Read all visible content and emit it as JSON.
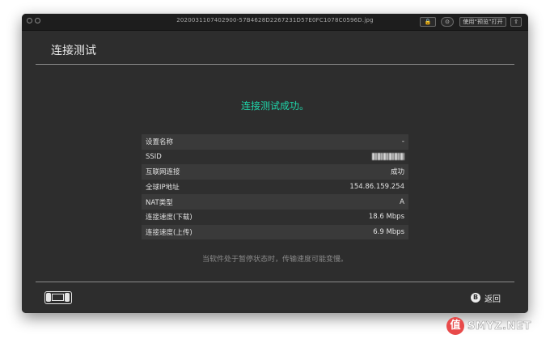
{
  "window": {
    "title": "2020031107402900-57B4628D2267231D57E0FC1078C0596D.jpg",
    "buttons": {
      "lock": "🔒",
      "markup": "⊙",
      "open_preview": "使用“预览”打开",
      "share": "⇧"
    }
  },
  "page": {
    "title": "连接测试",
    "result": "连接测试成功。",
    "rows": [
      {
        "label": "设置名称",
        "value": "-"
      },
      {
        "label": "SSID",
        "value": ""
      },
      {
        "label": "互联网连接",
        "value": "成功"
      },
      {
        "label": "全球IP地址",
        "value": "154.86.159.254"
      },
      {
        "label": "NAT类型",
        "value": "A"
      },
      {
        "label": "连接速度(下载)",
        "value": "18.6 Mbps"
      },
      {
        "label": "连接速度(上传)",
        "value": "6.9 Mbps"
      }
    ],
    "note": "当软件处于暂停状态时，传输速度可能变慢。"
  },
  "footer": {
    "b_glyph": "B",
    "back_label": "返回"
  },
  "watermark": {
    "glyph": "值",
    "text": "SMYZ.NET"
  },
  "colors": {
    "accent": "#1fd6aa",
    "background": "#2d2d2d"
  }
}
